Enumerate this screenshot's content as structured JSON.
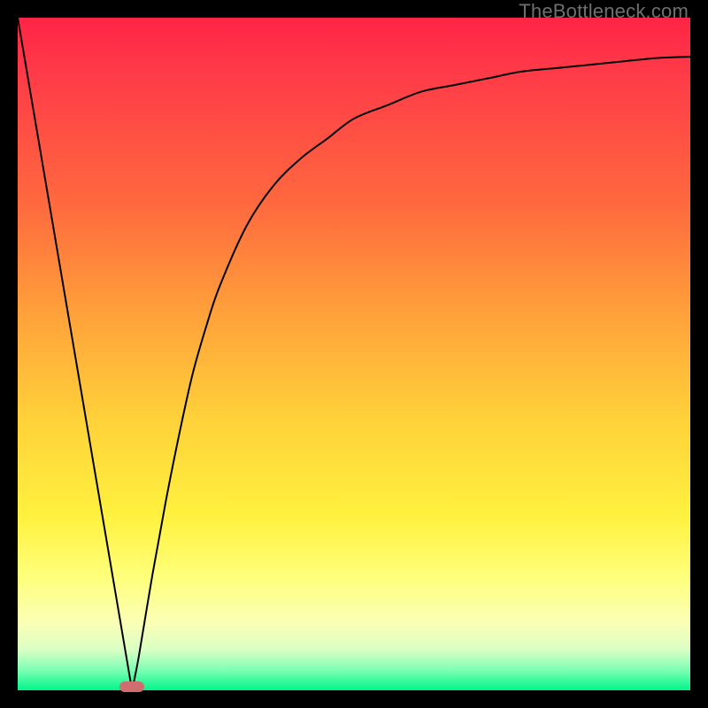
{
  "watermark": "TheBottleneck.com",
  "gradient_colors": [
    "#ff2446",
    "#ff3a48",
    "#ff6a3e",
    "#ffa13a",
    "#ffd23a",
    "#fff13e",
    "#ffff7a",
    "#fbffb6",
    "#d9ffc4",
    "#7cffb4",
    "#00f58a"
  ],
  "chart_data": {
    "type": "line",
    "title": "",
    "xlabel": "",
    "ylabel": "",
    "xlim": [
      0,
      100
    ],
    "ylim": [
      0,
      100
    ],
    "x": [
      0,
      2,
      4,
      6,
      8,
      10,
      12,
      14,
      16,
      17,
      18,
      20,
      22,
      24,
      26,
      28,
      30,
      34,
      38,
      42,
      46,
      50,
      55,
      60,
      65,
      70,
      75,
      80,
      85,
      90,
      95,
      100
    ],
    "values": [
      100,
      88,
      76,
      65,
      53,
      41,
      29,
      18,
      6,
      0,
      5,
      17,
      28,
      38,
      47,
      54,
      60,
      69,
      75,
      79,
      82,
      85,
      87,
      89,
      90,
      91,
      92,
      92.5,
      93,
      93.5,
      94,
      94.2
    ],
    "notch_x": 17,
    "annotations": [
      {
        "kind": "marker",
        "x": 17,
        "y": 0,
        "color": "#cf6d6f"
      }
    ]
  }
}
